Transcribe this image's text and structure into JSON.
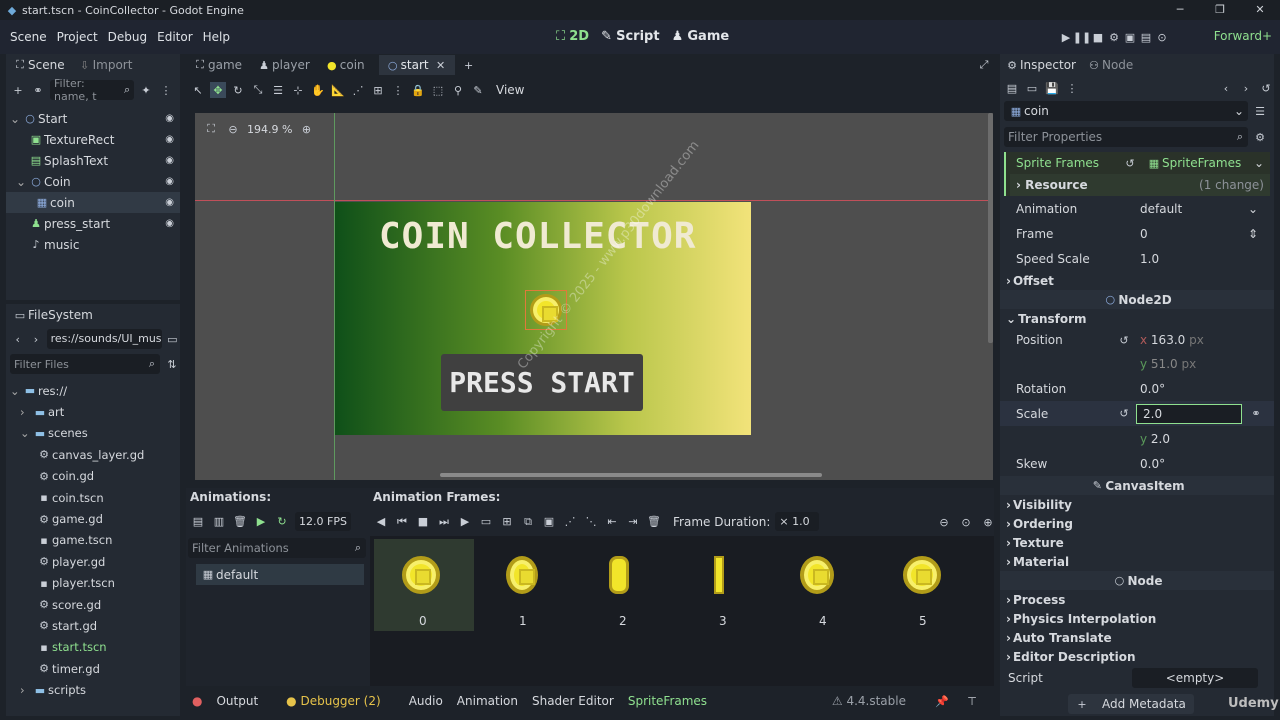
{
  "window": {
    "title": "start.tscn - CoinCollector - Godot Engine"
  },
  "menu": [
    "Scene",
    "Project",
    "Debug",
    "Editor",
    "Help"
  ],
  "modes": {
    "m2d": "2D",
    "script": "Script",
    "game": "Game"
  },
  "renderer": "Forward+",
  "left_tabs": {
    "scene": "Scene",
    "import": "Import"
  },
  "scene_filter": "Filter: name, t",
  "scene_tree": [
    {
      "label": "Start",
      "indent": 0
    },
    {
      "label": "TextureRect",
      "indent": 1
    },
    {
      "label": "SplashText",
      "indent": 1
    },
    {
      "label": "Coin",
      "indent": 1
    },
    {
      "label": "coin",
      "indent": 2
    },
    {
      "label": "press_start",
      "indent": 1
    },
    {
      "label": "music",
      "indent": 1
    }
  ],
  "filesystem": {
    "title": "FileSystem",
    "path": "res://sounds/UI_music",
    "filter": "Filter Files",
    "items": [
      {
        "label": "res://",
        "indent": 0
      },
      {
        "label": "art",
        "indent": 1
      },
      {
        "label": "scenes",
        "indent": 1
      },
      {
        "label": "canvas_layer.gd",
        "indent": 2
      },
      {
        "label": "coin.gd",
        "indent": 2
      },
      {
        "label": "coin.tscn",
        "indent": 2
      },
      {
        "label": "game.gd",
        "indent": 2
      },
      {
        "label": "game.tscn",
        "indent": 2
      },
      {
        "label": "player.gd",
        "indent": 2
      },
      {
        "label": "player.tscn",
        "indent": 2
      },
      {
        "label": "score.gd",
        "indent": 2
      },
      {
        "label": "start.gd",
        "indent": 2
      },
      {
        "label": "start.tscn",
        "indent": 2
      },
      {
        "label": "timer.gd",
        "indent": 2
      },
      {
        "label": "scripts",
        "indent": 1
      }
    ]
  },
  "scene_tabs": [
    "game",
    "player",
    "coin",
    "start"
  ],
  "viewport_toolbar": {
    "view": "View",
    "zoom": "194.9 %"
  },
  "game": {
    "title": "COIN COLLECTOR",
    "button": "PRESS START",
    "watermark": "Copyright © 2025 - www.p30download.com"
  },
  "animations": {
    "header": "Animations:",
    "fps": "12.0 FPS",
    "filter": "Filter Animations",
    "items": [
      "default"
    ]
  },
  "frames": {
    "header": "Animation Frames:",
    "duration_label": "Frame Duration:",
    "duration": "× 1.0",
    "labels": [
      "0",
      "1",
      "2",
      "3",
      "4",
      "5"
    ]
  },
  "inspector": {
    "tabs": {
      "inspector": "Inspector",
      "node": "Node"
    },
    "object": "coin",
    "filter": "Filter Properties",
    "sprite_frames_label": "Sprite Frames",
    "sprite_frames_value": "SpriteFrames",
    "resource_label": "Resource",
    "resource_change": "(1 change)",
    "animation_label": "Animation",
    "animation_value": "default",
    "frame_label": "Frame",
    "frame_value": "0",
    "speed_label": "Speed Scale",
    "speed_value": "1.0",
    "offset": "Offset",
    "node2d": "Node2D",
    "transform": "Transform",
    "position_label": "Position",
    "pos_x": "163.0",
    "pos_y": "51.0",
    "px": "px",
    "rotation_label": "Rotation",
    "rotation_value": "0.0",
    "scale_label": "Scale",
    "scale_x": "2.0",
    "scale_y": "2.0",
    "skew_label": "Skew",
    "skew_value": "0.0",
    "canvasitem": "CanvasItem",
    "ci_sections": [
      "Visibility",
      "Ordering",
      "Texture",
      "Material"
    ],
    "node": "Node",
    "node_sections": [
      "Process",
      "Physics Interpolation",
      "Auto Translate",
      "Editor Description"
    ],
    "script_label": "Script",
    "script_value": "<empty>",
    "add_metadata": "Add Metadata"
  },
  "bottom_tabs": [
    "Output",
    "Debugger (2)",
    "Audio",
    "Animation",
    "Shader Editor",
    "SpriteFrames"
  ],
  "version": "4.4.stable",
  "brand": "Udemy"
}
